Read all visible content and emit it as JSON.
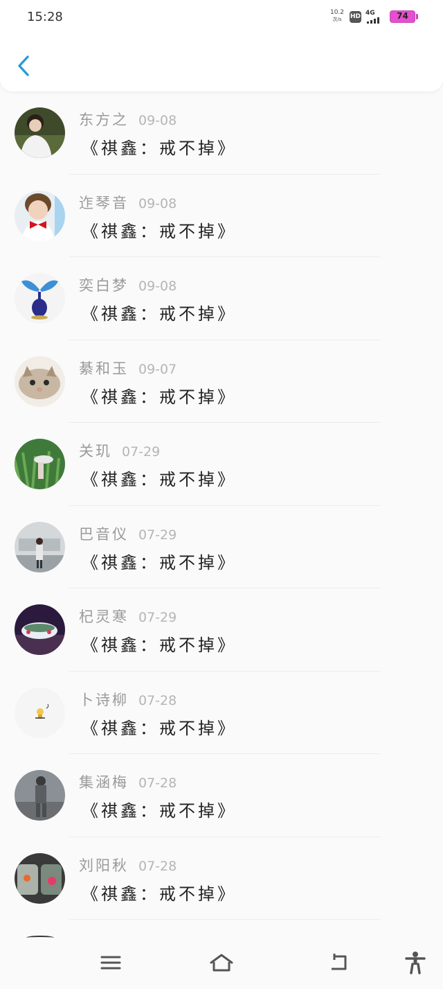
{
  "status_bar": {
    "time": "15:28",
    "net_speed_value": "10.2",
    "net_speed_unit": "次/s",
    "hd_label": "HD",
    "network_label": "4G",
    "battery_level": "74",
    "battery_color": "#e64fcf"
  },
  "nav": {
    "back_icon": "chevron-left-icon",
    "accent_color": "#2a9bd8"
  },
  "list": {
    "items": [
      {
        "name": "东方之",
        "date": "09-08",
        "title": "《祺鑫：戒不掉》",
        "avatar": "avatar-boy-outdoor"
      },
      {
        "name": "迮琴音",
        "date": "09-08",
        "title": "《祺鑫：戒不掉》",
        "avatar": "avatar-child-red-bowtie"
      },
      {
        "name": "奕白梦",
        "date": "09-08",
        "title": "《祺鑫：戒不掉》",
        "avatar": "avatar-glass-butterfly"
      },
      {
        "name": "綦和玉",
        "date": "09-07",
        "title": "《祺鑫：戒不掉》",
        "avatar": "avatar-kitten"
      },
      {
        "name": "关玑",
        "date": "07-29",
        "title": "《祺鑫：戒不掉》",
        "avatar": "avatar-person-in-grass"
      },
      {
        "name": "巴音仪",
        "date": "07-29",
        "title": "《祺鑫：戒不掉》",
        "avatar": "avatar-girl-street"
      },
      {
        "name": "杞灵寒",
        "date": "07-29",
        "title": "《祺鑫：戒不掉》",
        "avatar": "avatar-teacup"
      },
      {
        "name": "卜诗柳",
        "date": "07-28",
        "title": "《祺鑫：戒不掉》",
        "avatar": "avatar-cartoon-sticker"
      },
      {
        "name": "集涵梅",
        "date": "07-28",
        "title": "《祺鑫：戒不掉》",
        "avatar": "avatar-person-gray"
      },
      {
        "name": "刘阳秋",
        "date": "07-28",
        "title": "《祺鑫：戒不掉》",
        "avatar": "avatar-flower-jars"
      }
    ]
  },
  "bottom_nav": {
    "items": [
      {
        "icon": "menu-icon"
      },
      {
        "icon": "home-icon"
      },
      {
        "icon": "back-arrow-icon"
      },
      {
        "icon": "accessibility-icon"
      }
    ]
  }
}
